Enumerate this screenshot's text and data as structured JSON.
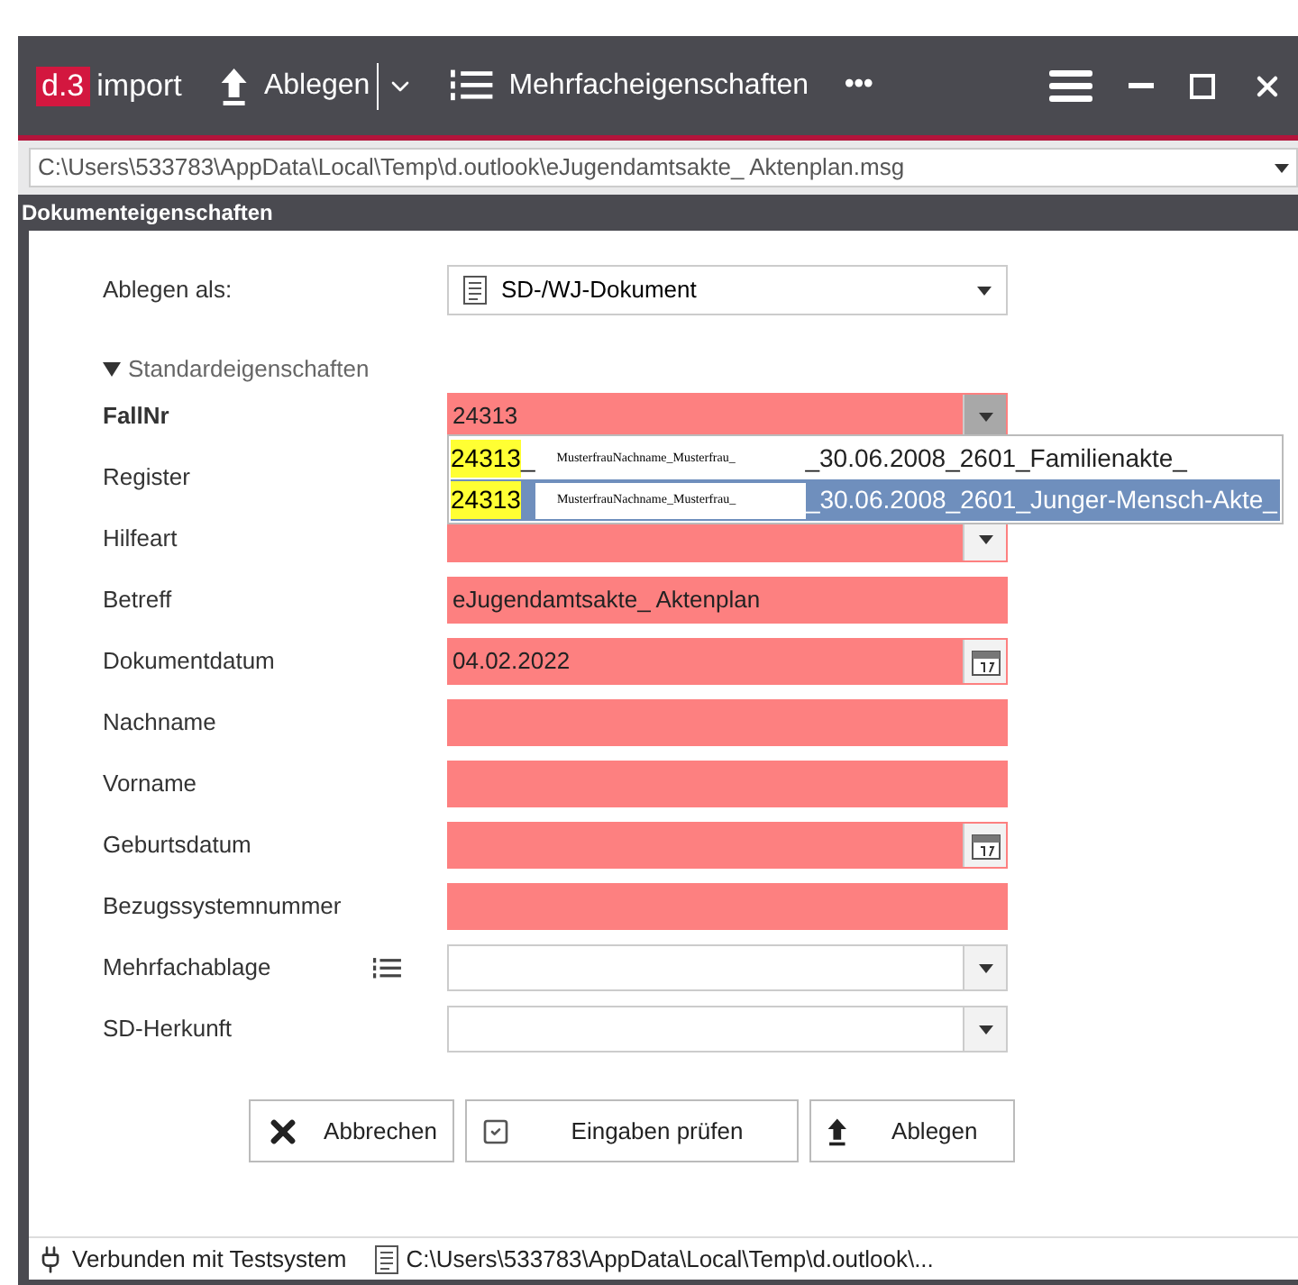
{
  "titlebar": {
    "logo_mark": "d.3",
    "logo_text": "import",
    "buttons": [
      {
        "kind": "upload",
        "label": "Ablegen",
        "caret": true
      },
      {
        "kind": "list",
        "label": "Mehrfacheigenschaften"
      }
    ],
    "more": "•••"
  },
  "path": "C:\\Users\\533783\\AppData\\Local\\Temp\\d.outlook\\eJugendamtsakte_ Aktenplan.msg",
  "section_title": "Dokumenteigenschaften",
  "ablegen_als": {
    "label": "Ablegen als:",
    "value": "SD-/WJ-Dokument"
  },
  "group": {
    "label": "Standardeigenschaften",
    "expanded": true
  },
  "fields": [
    {
      "label": "FallNr",
      "kind": "combo",
      "value": "24313",
      "invalid": true,
      "bold": true,
      "focused": true
    },
    {
      "label": "Register",
      "kind": "covered"
    },
    {
      "label": "Hilfeart",
      "kind": "combo",
      "invalid": true
    },
    {
      "label": "Betreff",
      "kind": "text",
      "value": "eJugendamtsakte_ Aktenplan",
      "invalid": true
    },
    {
      "label": "Dokumentdatum",
      "kind": "date",
      "value": "04.02.2022",
      "invalid": true
    },
    {
      "label": "Nachname",
      "kind": "text",
      "invalid": true
    },
    {
      "label": "Vorname",
      "kind": "text",
      "invalid": true
    },
    {
      "label": "Geburtsdatum",
      "kind": "date",
      "invalid": true
    },
    {
      "label": "Bezugssystemnummer",
      "kind": "text",
      "invalid": true
    },
    {
      "label": "Mehrfachablage",
      "kind": "combo",
      "invalid": false,
      "list_icon": true
    },
    {
      "label": "SD-Herkunft",
      "kind": "combo",
      "invalid": false
    }
  ],
  "suggestions": [
    {
      "match": "24313",
      "after": "_",
      "name": "MusterfrauNachname_Musterfrau_",
      "rest": "_30.06.2008_2601_Familienakte_",
      "selected": false
    },
    {
      "match": "24313",
      "name": "MusterfrauNachname_Musterfrau_",
      "rest": "_30.06.2008_2601_Junger-Mensch-Akte_",
      "selected": true
    }
  ],
  "actions": [
    {
      "kind": "cancel",
      "label": "Abbrechen"
    },
    {
      "kind": "check",
      "label": "Eingaben prüfen"
    },
    {
      "kind": "upload",
      "label": "Ablegen"
    }
  ],
  "status_bar": {
    "connection": "Verbunden mit Testsystem",
    "file": "C:\\Users\\533783\\AppData\\Local\\Temp\\d.outlook\\..."
  }
}
